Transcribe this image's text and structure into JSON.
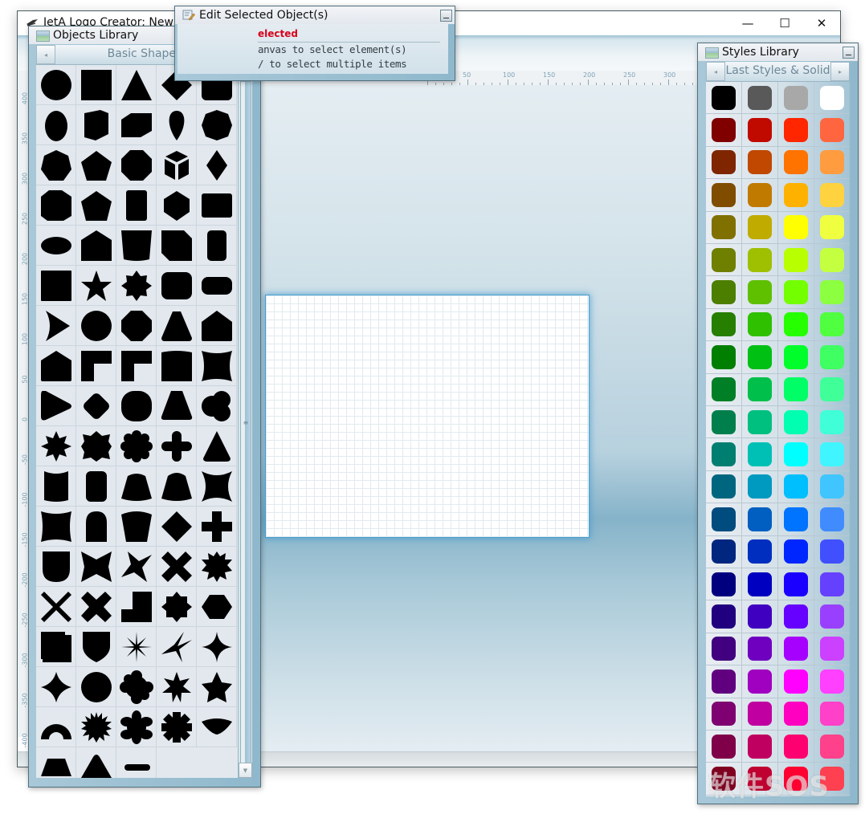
{
  "window": {
    "title": "JetA Logo Creator: New Proj",
    "controls": {
      "minimize": "—",
      "maximize": "☐",
      "close": "✕"
    }
  },
  "rulers": {
    "horizontal_labels": [
      "50",
      "100",
      "150",
      "200",
      "250",
      "300"
    ],
    "vertical_labels": [
      "400",
      "350",
      "300",
      "250",
      "200",
      "150",
      "100",
      "50",
      "0",
      "-50",
      "-100",
      "-150",
      "-200",
      "-250",
      "-300",
      "-350",
      "-400"
    ]
  },
  "edit_panel": {
    "title": "Edit Selected Object(s)",
    "status": "elected",
    "hints": [
      "anvas to select element(s)",
      "/ to select multiple items"
    ]
  },
  "objects_panel": {
    "title": "Objects Library",
    "category": "Basic Shapes",
    "prev_label": "◂",
    "next_label": "▸",
    "shapes": [
      "circle",
      "square",
      "triangle",
      "diamond",
      "rounded-square",
      "egg",
      "irregular-pentagon",
      "chamfered-rect",
      "teardrop",
      "heptagon",
      "heptagon-2",
      "pentagon",
      "octagon",
      "cube",
      "rhombus",
      "hexagon-irregular",
      "pentagon-2",
      "tall-rounded-rect",
      "hexagon",
      "wide-rect",
      "ellipse",
      "house",
      "trapezoid-cup",
      "snipped-corner-rect",
      "cylinder",
      "notched-square",
      "star-5",
      "star-8",
      "rounded-rect",
      "pill-rect",
      "pie-wedge",
      "scalloped-circle",
      "concave-octagon",
      "rounded-triangle",
      "arched-pentagon",
      "pentagon-home",
      "l-corner",
      "l-corner-2",
      "arched-rect",
      "concave-square",
      "rounded-play",
      "rounded-diamond",
      "rounded-octagon",
      "rounded-trapezoid",
      "cloud",
      "star-8-spiky",
      "concave-star-8",
      "flower-8",
      "plus-rounded",
      "cone",
      "cylinder-concave",
      "cylinder-2",
      "arched-trapezoid",
      "dome-trapezoid",
      "concave-star-4",
      "concave-rect",
      "bullet",
      "shield-pentagon",
      "diamond-2",
      "cross",
      "shield",
      "bowtie",
      "pinwheel",
      "x-bold",
      "gear-spiky",
      "x-thin",
      "x-wide",
      "stair",
      "star-8-round",
      "hexagon-wide",
      "folded-square",
      "shield-pointed",
      "sparkle-8",
      "sparkle-4-skew",
      "sparkle-4",
      "star-4-concave",
      "seal",
      "flower-blob",
      "star-7",
      "star-5-round",
      "arch",
      "starburst",
      "flower-6",
      "asterisk",
      "lens-bowl",
      "trapezoid",
      "rounded-triangle-2",
      "capsule-line"
    ]
  },
  "styles_panel": {
    "title": "Styles Library",
    "category": "Last Styles & Solid",
    "prev_label": "◂",
    "next_label": "▸",
    "swatches": [
      [
        "#000000",
        "#595959",
        "#a8a8a8",
        "#ffffff"
      ],
      [
        "#800000",
        "#c00a00",
        "#ff2600",
        "#ff6640"
      ],
      [
        "#7f2600",
        "#c04800",
        "#ff7300",
        "#ff9c40"
      ],
      [
        "#804c00",
        "#c07a00",
        "#ffb100",
        "#ffd240"
      ],
      [
        "#807000",
        "#c0ab00",
        "#ffff00",
        "#efff40"
      ],
      [
        "#6f7f00",
        "#9ec000",
        "#b8ff00",
        "#c4ff40"
      ],
      [
        "#4c7f00",
        "#5fc000",
        "#73ff00",
        "#8cff40"
      ],
      [
        "#267f00",
        "#2fc000",
        "#26ff00",
        "#50ff40"
      ],
      [
        "#007f00",
        "#00c013",
        "#00ff2a",
        "#40ff62"
      ],
      [
        "#007f26",
        "#00c04b",
        "#00ff66",
        "#40ff99"
      ],
      [
        "#007f4c",
        "#00c080",
        "#00ffb0",
        "#40ffd8"
      ],
      [
        "#007f70",
        "#00c0b5",
        "#00ffff",
        "#40f5ff"
      ],
      [
        "#00667f",
        "#0099c0",
        "#00bfff",
        "#40c5ff"
      ],
      [
        "#004c7f",
        "#005fc0",
        "#0073ff",
        "#408cff"
      ],
      [
        "#00267f",
        "#002fc0",
        "#0026ff",
        "#4050ff"
      ],
      [
        "#00007f",
        "#0000c0",
        "#1a00ff",
        "#6640ff"
      ],
      [
        "#20007f",
        "#4000c0",
        "#6600ff",
        "#9940ff"
      ],
      [
        "#40007f",
        "#7000c0",
        "#a600ff",
        "#cc40ff"
      ],
      [
        "#60007f",
        "#a000c0",
        "#ff00ff",
        "#ff40ff"
      ],
      [
        "#7f0070",
        "#c000a0",
        "#ff00c0",
        "#ff40c8"
      ],
      [
        "#7f0048",
        "#c00060",
        "#ff0070",
        "#ff408a"
      ],
      [
        "#800020",
        "#c00030",
        "#ff0030",
        "#ff4050"
      ]
    ]
  },
  "watermark": "软件SOS"
}
